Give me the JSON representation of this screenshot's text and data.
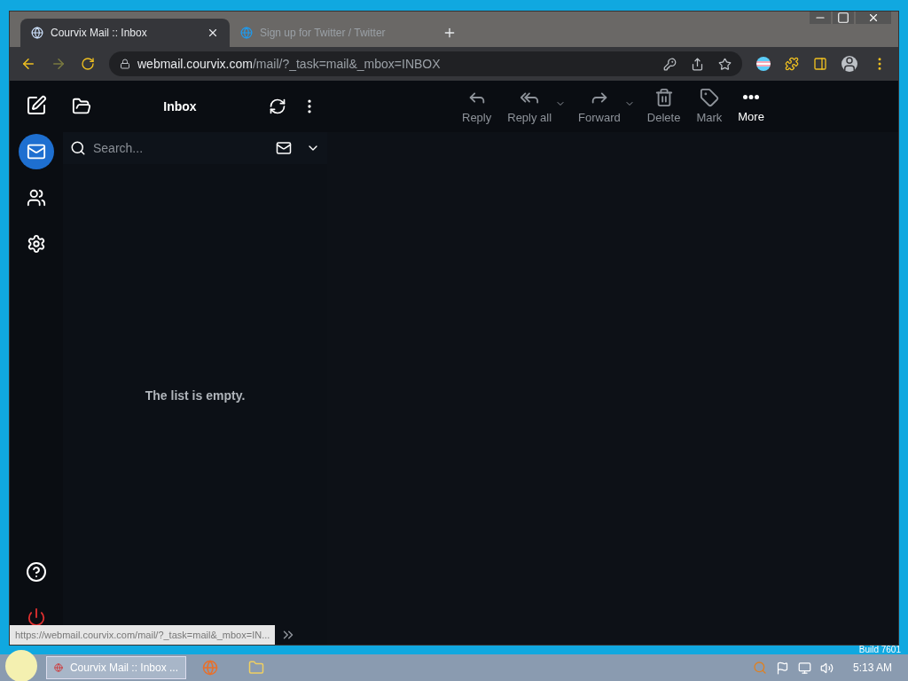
{
  "browser": {
    "tabs": [
      {
        "title": "Courvix Mail :: Inbox",
        "selected": true
      },
      {
        "title": "Sign up for Twitter / Twitter",
        "selected": false
      }
    ],
    "address": {
      "host": "webmail.courvix.com",
      "path": "/mail/?_task=mail&_mbox=INBOX"
    },
    "status_url": "https://webmail.courvix.com/mail/?_task=mail&_mbox=IN..."
  },
  "nav": [
    {
      "kind": "mail",
      "selected": true
    },
    {
      "kind": "contacts",
      "selected": false
    },
    {
      "kind": "settings",
      "selected": false
    }
  ],
  "folder_header": {
    "title": "Inbox"
  },
  "search": {
    "placeholder": "Search..."
  },
  "list_message": "The list is empty.",
  "toolbar": [
    {
      "kind": "reply",
      "label": "Reply",
      "dropdown": false,
      "highlighted": false
    },
    {
      "kind": "replyall",
      "label": "Reply all",
      "dropdown": true,
      "highlighted": false
    },
    {
      "kind": "forward",
      "label": "Forward",
      "dropdown": true,
      "highlighted": false
    },
    {
      "kind": "delete",
      "label": "Delete",
      "dropdown": false,
      "highlighted": false
    },
    {
      "kind": "mark",
      "label": "Mark",
      "dropdown": false,
      "highlighted": false
    },
    {
      "kind": "more",
      "label": "More",
      "dropdown": false,
      "highlighted": true
    }
  ],
  "desktop": {
    "build": "Build 7601"
  },
  "taskbar": {
    "task": "Courvix Mail :: Inbox ...",
    "clock": "5:13 AM"
  }
}
